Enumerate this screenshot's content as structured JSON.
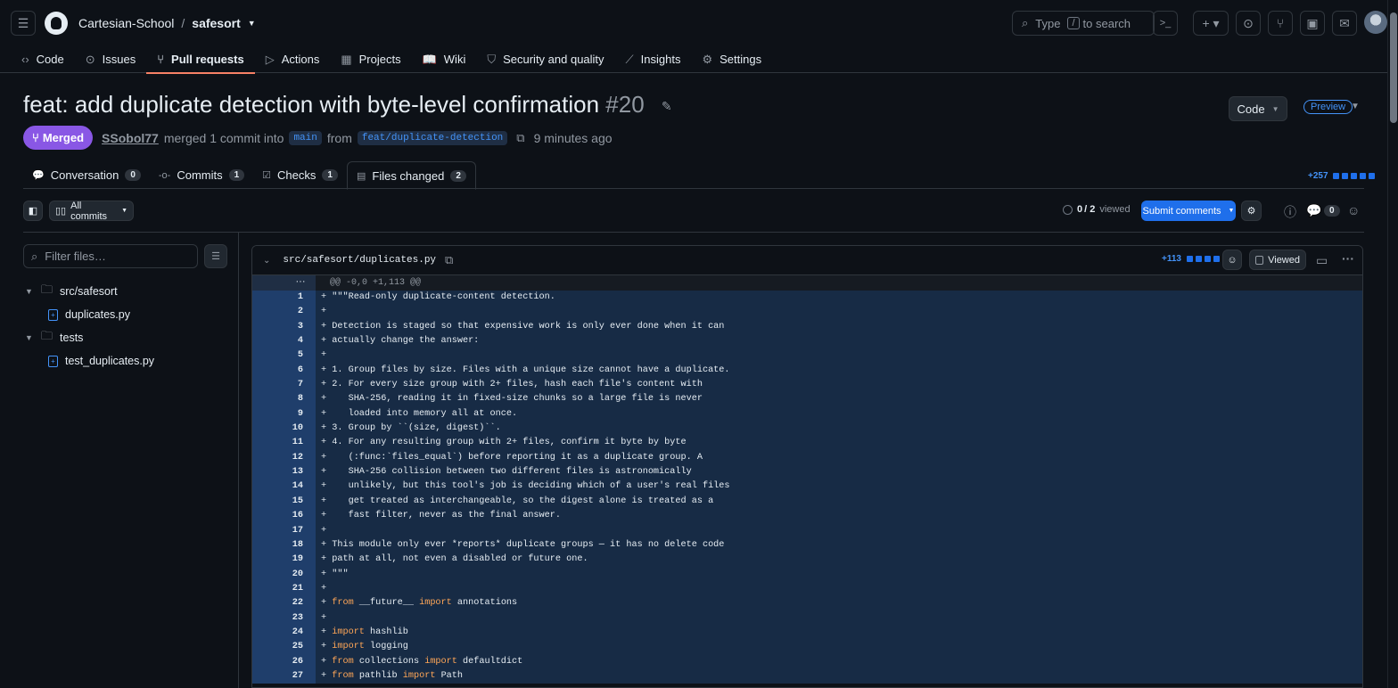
{
  "header": {
    "org": "Cartesian-School",
    "sep": "/",
    "repo": "safesort",
    "search_prefix": "Type",
    "search_key": "/",
    "search_suffix": "to search"
  },
  "repo_tabs": [
    {
      "label": "Code",
      "icon": "code-icon",
      "glyph": "‹›"
    },
    {
      "label": "Issues",
      "icon": "issue-icon",
      "glyph": "⊙"
    },
    {
      "label": "Pull requests",
      "icon": "pull-request-icon",
      "glyph": "⑂",
      "active": true
    },
    {
      "label": "Actions",
      "icon": "play-icon",
      "glyph": "▷"
    },
    {
      "label": "Projects",
      "icon": "table-icon",
      "glyph": "▦"
    },
    {
      "label": "Wiki",
      "icon": "book-icon",
      "glyph": "📖"
    },
    {
      "label": "Security and quality",
      "icon": "shield-icon",
      "glyph": "⛉"
    },
    {
      "label": "Insights",
      "icon": "graph-icon",
      "glyph": "⟋"
    },
    {
      "label": "Settings",
      "icon": "gear-icon",
      "glyph": "⚙"
    }
  ],
  "pr": {
    "title": "feat: add duplicate detection with byte-level confirmation",
    "number": "#20",
    "status": "Merged",
    "author": "SSobol77",
    "merged_text": "merged 1 commit into",
    "base": "main",
    "from_text": "from",
    "head": "feat/duplicate-detection",
    "time": "9 minutes ago",
    "code_button": "Code",
    "preview": "Preview"
  },
  "pr_tabs": [
    {
      "label": "Conversation",
      "count": "0",
      "icon": "comment-icon",
      "glyph": "💬"
    },
    {
      "label": "Commits",
      "count": "1",
      "icon": "commit-icon",
      "glyph": "-o-"
    },
    {
      "label": "Checks",
      "count": "1",
      "icon": "checklist-icon",
      "glyph": "☑"
    },
    {
      "label": "Files changed",
      "count": "2",
      "icon": "file-diff-icon",
      "glyph": "▤",
      "active": true
    }
  ],
  "diffstat": "+257",
  "toolbar": {
    "all_commits": "All commits",
    "viewed_count": "0",
    "viewed_total": "/ 2",
    "viewed_label": "viewed",
    "submit": "Submit comments",
    "comments_count": "0"
  },
  "sidebar": {
    "filter_placeholder": "Filter files…",
    "tree": [
      {
        "type": "folder",
        "label": "src/safesort",
        "depth": 0
      },
      {
        "type": "file",
        "label": "duplicates.py",
        "depth": 1
      },
      {
        "type": "folder",
        "label": "tests",
        "depth": 0
      },
      {
        "type": "file",
        "label": "test_duplicates.py",
        "depth": 1
      }
    ]
  },
  "diff": {
    "path": "src/safesort/duplicates.py",
    "additions": "+113",
    "viewed_label": "Viewed",
    "hunk": "@@ -0,0 +1,113 @@",
    "lines": [
      "\"\"\"Read-only duplicate-content detection.",
      "",
      "Detection is staged so that expensive work is only ever done when it can",
      "actually change the answer:",
      "",
      "1. Group files by size. Files with a unique size cannot have a duplicate.",
      "2. For every size group with 2+ files, hash each file's content with",
      "   SHA-256, reading it in fixed-size chunks so a large file is never",
      "   loaded into memory all at once.",
      "3. Group by ``(size, digest)``.",
      "4. For any resulting group with 2+ files, confirm it byte by byte",
      "   (:func:`files_equal`) before reporting it as a duplicate group. A",
      "   SHA-256 collision between two different files is astronomically",
      "   unlikely, but this tool's job is deciding which of a user's real files",
      "   get treated as interchangeable, so the digest alone is treated as a",
      "   fast filter, never as the final answer.",
      "",
      "This module only ever *reports* duplicate groups — it has no delete code",
      "path at all, not even a disabled or future one.",
      "\"\"\"",
      "",
      "from __future__ import annotations",
      "",
      "import hashlib",
      "import logging",
      "from collections import defaultdict",
      "from pathlib import Path"
    ]
  }
}
